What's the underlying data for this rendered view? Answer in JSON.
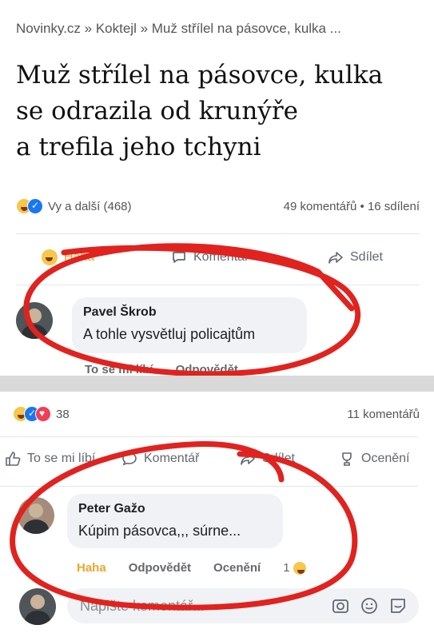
{
  "post1": {
    "breadcrumb": "Novinky.cz » Koktejl » Muž střílel na pásovce, kulka ...",
    "headline_lines": [
      "Muž střílel na pásovce, kulka",
      "se odrazila od krunýře",
      "a trefila jeho tchyni"
    ],
    "reactions_text": "Vy a další (468)",
    "stats_text": "49 komentářů • 16 sdílení",
    "actions": {
      "haha": "Haha",
      "comment": "Komentář",
      "share": "Sdílet"
    },
    "comment": {
      "author": "Pavel Škrob",
      "text": "A tohle vysvětluj policajtům",
      "like": "To se mi líbí",
      "reply": "Odpovědět"
    }
  },
  "post2": {
    "reactions_count": "38",
    "comments_count": "11 komentářů",
    "actions": {
      "like": "To se mi líbí",
      "comment": "Komentář",
      "share": "Sdílet",
      "award": "Ocenění"
    },
    "comment": {
      "author": "Peter Gažo",
      "text": "Kúpim pásovca,,, súrne...",
      "haha": "Haha",
      "reply": "Odpovědět",
      "award": "Ocenění",
      "reaction_count": "1"
    },
    "write_placeholder": "Napište komentář..."
  },
  "icons": [
    "haha-icon",
    "like-icon",
    "love-icon",
    "comment-icon",
    "share-icon",
    "award-icon",
    "camera-icon",
    "smiley-icon",
    "sticker-icon"
  ],
  "colors": {
    "annotation_red": "#e0231f",
    "haha_orange": "#f0a52a",
    "fb_blue": "#1877f2"
  }
}
